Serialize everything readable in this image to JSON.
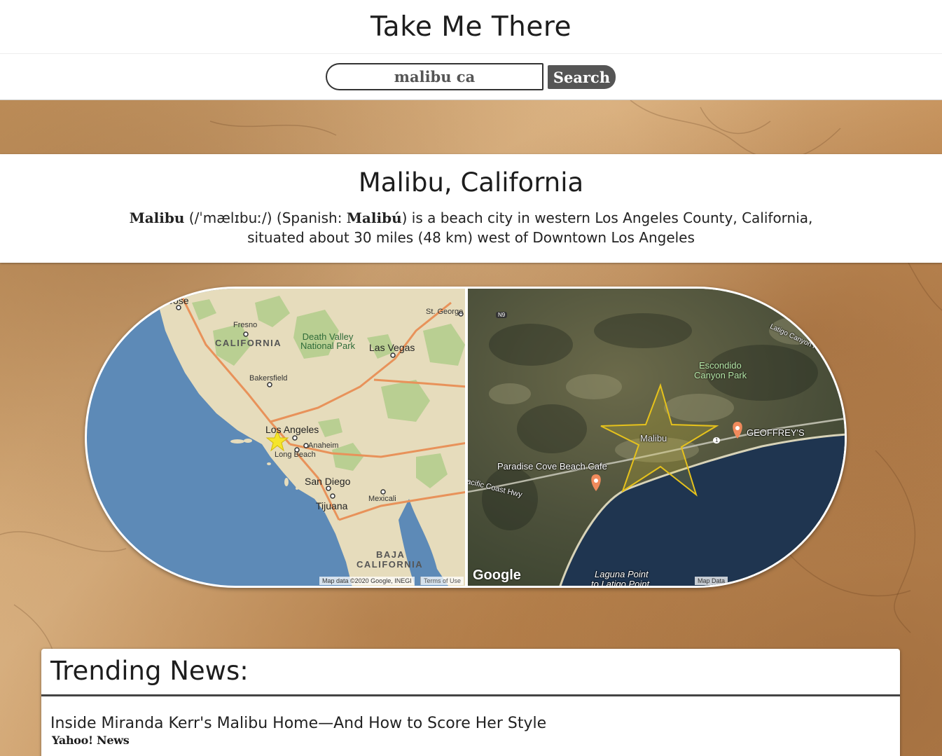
{
  "app": {
    "title": "Take Me There"
  },
  "search": {
    "value": "malibu ca",
    "button_label": "Search"
  },
  "place": {
    "title": "Malibu, California",
    "description": {
      "name": "Malibu",
      "pronunciation": " (/ˈmælɪbuː/) (Spanish: ",
      "spanish_name": "Malibú",
      "rest": ") is a beach city in western Los Angeles County, California, situated about 30 miles (48 km) west of Downtown Los Angeles"
    }
  },
  "maps": {
    "road_map": {
      "labels": {
        "jose": "Jose",
        "st_george": "St. George",
        "fresno": "Fresno",
        "california": "CALIFORNIA",
        "death_valley": "Death Valley\nNational Park",
        "las_vegas": "Las Vegas",
        "bakersfield": "Bakersfield",
        "los_angeles": "Los Angeles",
        "anaheim": "Anaheim",
        "long_beach": "Long Beach",
        "san_diego": "San Diego",
        "tijuana": "Tijuana",
        "mexicali": "Mexicali",
        "baja": "BAJA",
        "baja_california": "CALIFORNIA"
      },
      "attribution": "Map data ©2020 Google, INEGI",
      "terms": "Terms of Use"
    },
    "satellite_map": {
      "labels": {
        "n9": "N9",
        "latigo_canyon": "Latigo Canyon Rd",
        "escondido_1": "Escondido",
        "escondido_2": "Canyon Park",
        "malibu": "Malibu",
        "geoffreys": "GEOFFREY'S",
        "paradise_cove": "Paradise Cove Beach Cafe",
        "pch": "Pacific Coast Hwy",
        "laguna_1": "Laguna Point",
        "laguna_2": "to Latigo Point",
        "route_1": "1"
      },
      "logo": "Google",
      "attribution": "Map Data"
    },
    "colors": {
      "ocean": "#5d8ab7",
      "land": "#e6dcbc",
      "park": "#b9cf92",
      "road": "#e8925a",
      "marker_star": "#f5e52a"
    }
  },
  "news": {
    "heading": "Trending News:",
    "items": [
      {
        "title": "Inside Miranda Kerr's Malibu Home—And How to Score Her Style",
        "source": "Yahoo! News"
      }
    ]
  }
}
